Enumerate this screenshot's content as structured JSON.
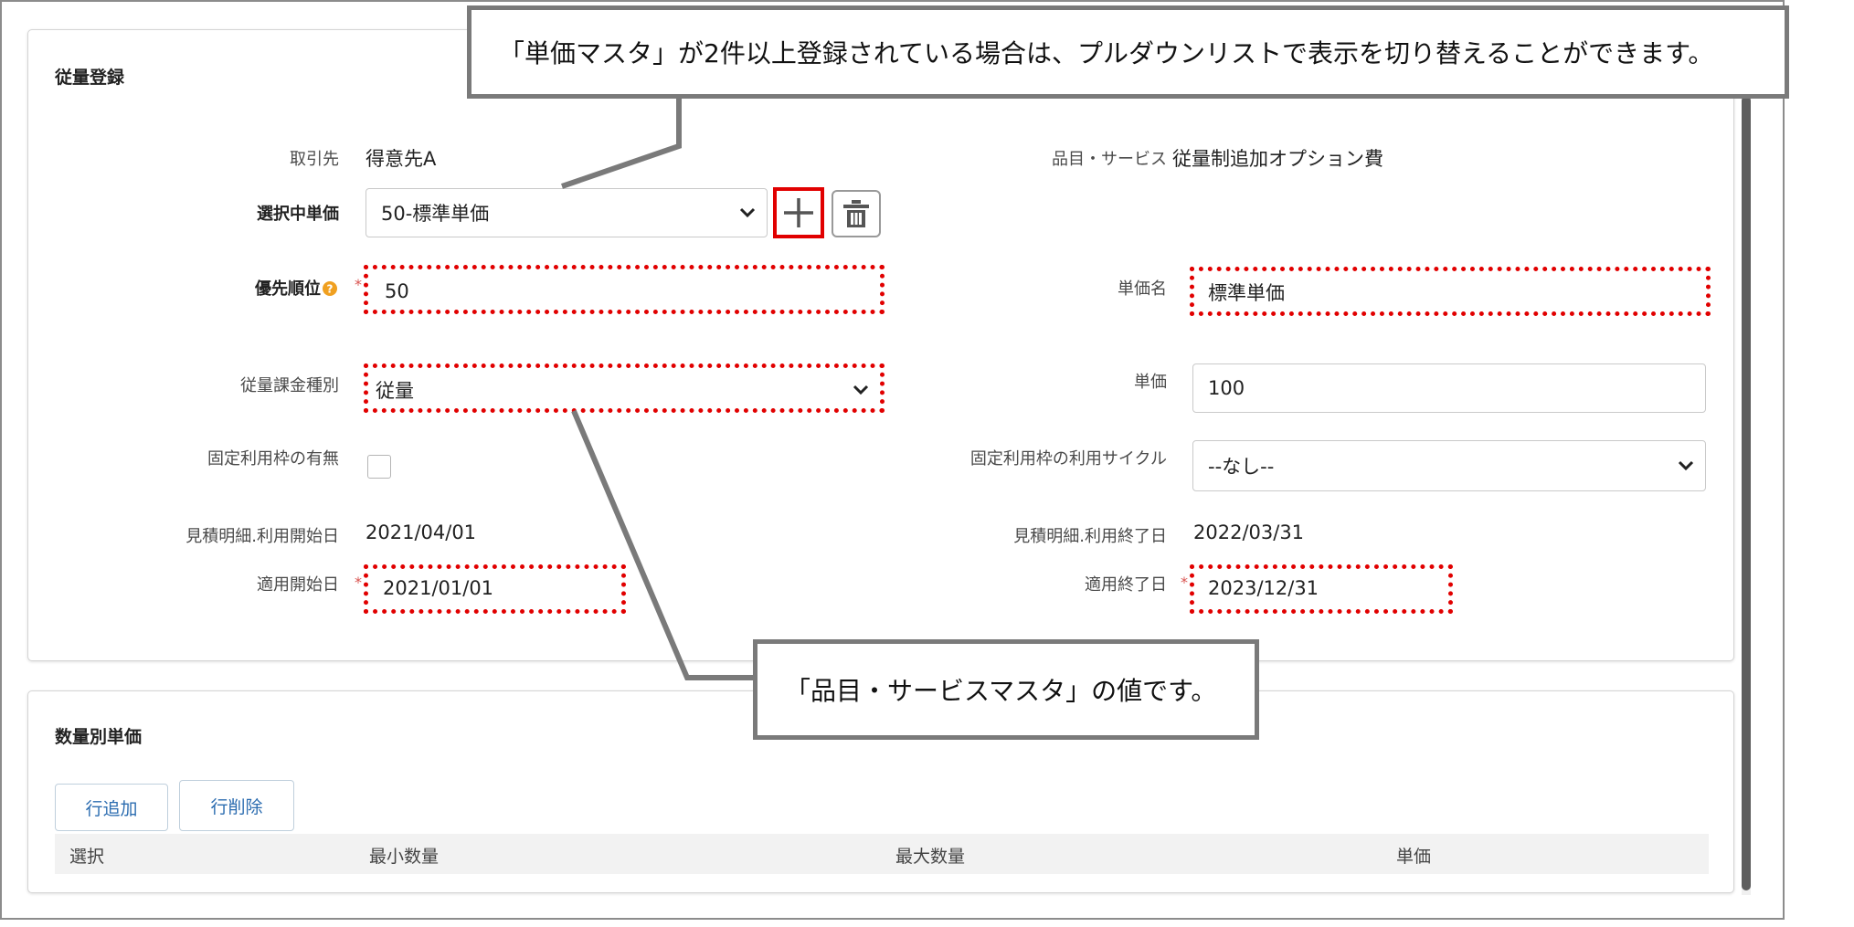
{
  "upper_panel": {
    "title": "従量登録",
    "client_label": "取引先",
    "client_value": "得意先A",
    "item_label": "品目・サービス",
    "item_value": "従量制追加オプション費",
    "selected_price_label": "選択中単価",
    "selected_price_value": "50-標準単価",
    "priority_label": "優先順位",
    "priority_value": "50",
    "price_name_label": "単価名",
    "price_name_value": "標準単価",
    "billing_type_label": "従量課金種別",
    "billing_type_value": "従量",
    "unit_price_label": "単価",
    "unit_price_value": "100",
    "fixed_quota_label": "固定利用枠の有無",
    "fixed_cycle_label": "固定利用枠の利用サイクル",
    "fixed_cycle_value": "--なし--",
    "est_start_label": "見積明細.利用開始日",
    "est_start_value": "2021/04/01",
    "est_end_label": "見積明細.利用終了日",
    "est_end_value": "2022/03/31",
    "apply_start_label": "適用開始日",
    "apply_start_value": "2021/01/01",
    "apply_end_label": "適用終了日",
    "apply_end_value": "2023/12/31",
    "required_mark": "*"
  },
  "lower_panel": {
    "title": "数量別単価",
    "add_row_label": "行追加",
    "delete_row_label": "行削除",
    "columns": [
      "選択",
      "最小数量",
      "最大数量",
      "単価"
    ]
  },
  "callouts": {
    "top": "「単価マスタ」が2件以上登録されている場合は、プルダウンリストで表示を切り替えることができます。",
    "bottom": "「品目・サービスマスタ」の値です。"
  },
  "icons": {
    "add": "plus-icon",
    "delete": "trash-icon",
    "help": "help-icon",
    "dropdown": "chevron-down-icon"
  },
  "colors": {
    "highlight": "#e10000",
    "link_blue": "#2b6cb0",
    "callout_border": "#7a7a7a",
    "help_orange": "#f0a020"
  }
}
